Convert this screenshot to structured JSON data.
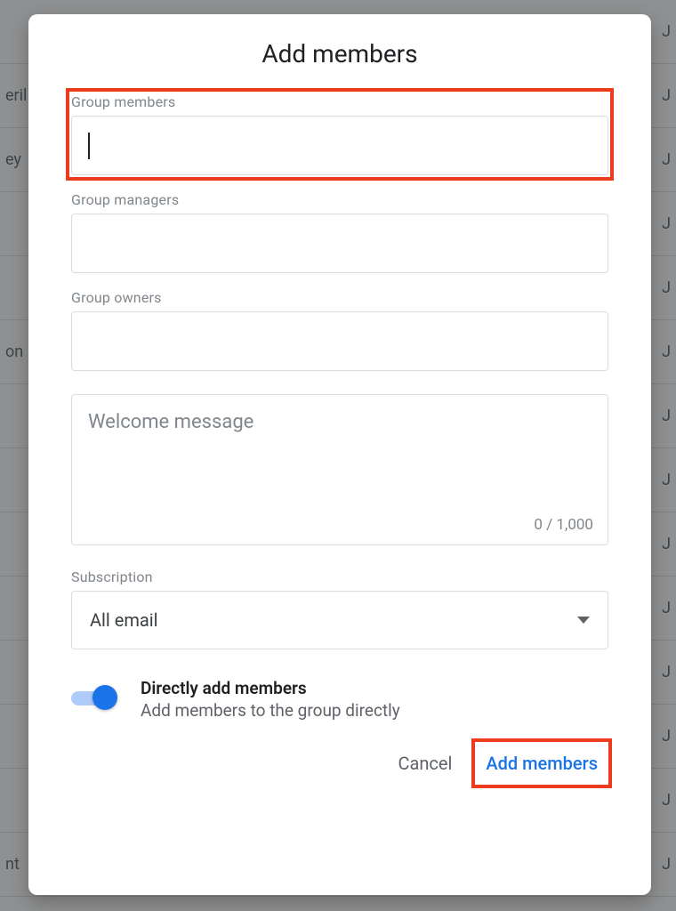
{
  "modal": {
    "title": "Add members",
    "group_members_label": "Group members",
    "group_members_value": "",
    "group_managers_label": "Group managers",
    "group_managers_value": "",
    "group_owners_label": "Group owners",
    "group_owners_value": "",
    "welcome_placeholder": "Welcome message",
    "welcome_value": "",
    "char_count": "0 / 1,000",
    "subscription_label": "Subscription",
    "subscription_value": "All email",
    "toggle": {
      "on": true,
      "title": "Directly add members",
      "desc": "Add members to the group directly"
    },
    "actions": {
      "cancel": "Cancel",
      "add": "Add members"
    }
  },
  "background_rows": [
    {
      "left": "",
      "right": "J"
    },
    {
      "left": "eril",
      "right": "J"
    },
    {
      "left": "ey",
      "right": "J"
    },
    {
      "left": "",
      "right": "J"
    },
    {
      "left": "",
      "right": "J"
    },
    {
      "left": "on",
      "right": "J"
    },
    {
      "left": "",
      "right": "J"
    },
    {
      "left": "",
      "right": "J"
    },
    {
      "left": "",
      "right": "J"
    },
    {
      "left": "",
      "right": "J"
    },
    {
      "left": "",
      "right": "J"
    },
    {
      "left": "",
      "right": "J"
    },
    {
      "left": "",
      "right": "J"
    },
    {
      "left": "nt",
      "right": "J"
    }
  ]
}
